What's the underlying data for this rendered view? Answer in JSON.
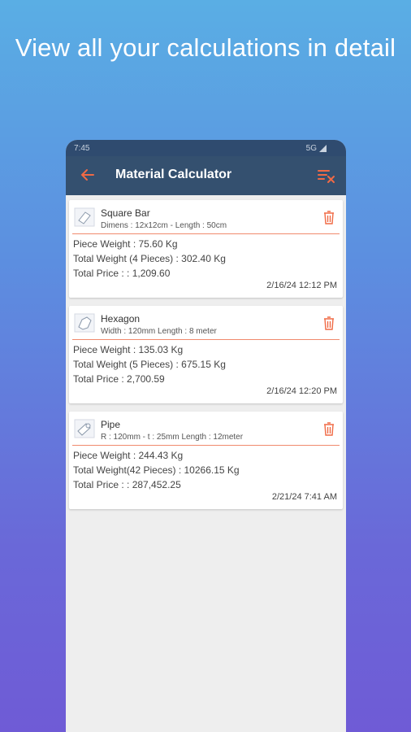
{
  "headline": "View all your calculations in detail",
  "status_bar": {
    "time": "7:45",
    "network": "5G"
  },
  "app_bar": {
    "title": "Material Calculator",
    "back_icon": "arrow-left-icon",
    "clear_icon": "clear-list-icon"
  },
  "colors": {
    "accent": "#f06a45",
    "app_bar": "#34506f",
    "status_bar": "#2f4b6f"
  },
  "items": [
    {
      "name": "Square Bar",
      "dims": "Dimens : 12x12cm - Length : 50cm",
      "line1": "Piece Weight : 75.60 Kg",
      "line2": "Total Weight (4 Pieces) : 302.40 Kg",
      "line3": "Total Price : : 1,209.60",
      "date": "2/16/24 12:12 PM"
    },
    {
      "name": "Hexagon",
      "dims": "Width : 120mm Length : 8 meter",
      "line1": "Piece Weight : 135.03 Kg",
      "line2": "Total Weight (5 Pieces) : 675.15 Kg",
      "line3": "Total Price : 2,700.59",
      "date": "2/16/24 12:20 PM"
    },
    {
      "name": "Pipe",
      "dims": "R : 120mm - t : 25mm Length : 12meter",
      "line1": "Piece Weight : 244.43 Kg",
      "line2": "Total Weight(42 Pieces) : 10266.15 Kg",
      "line3": "Total Price : : 287,452.25",
      "date": "2/21/24 7:41 AM"
    }
  ]
}
